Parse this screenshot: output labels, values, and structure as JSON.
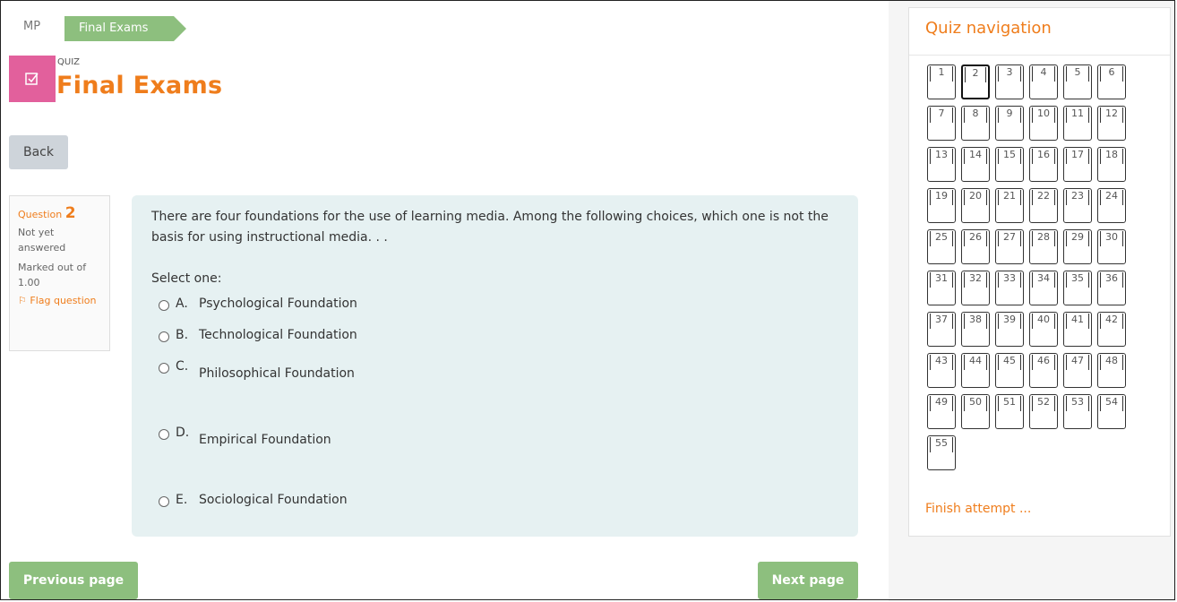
{
  "breadcrumb": {
    "root": "MP",
    "current": "Final Exams"
  },
  "quiz": {
    "label": "QUIZ",
    "title": "Final Exams"
  },
  "back_label": "Back",
  "question_info": {
    "question_word": "Question",
    "number": "2",
    "status": "Not yet answered",
    "marks": "Marked out of 1.00",
    "flag": "Flag question"
  },
  "question": {
    "text": "There are four foundations for the use of learning media. Among the following choices, which one is not the basis for using instructional media. . .",
    "select_label": "Select one:",
    "options": [
      {
        "letter": "A.",
        "text": "Psychological Foundation"
      },
      {
        "letter": "B.",
        "text": "Technological Foundation"
      },
      {
        "letter": "C.",
        "text": "Philosophical Foundation"
      },
      {
        "letter": "D.",
        "text": "Empirical Foundation"
      },
      {
        "letter": "E.",
        "text": "Sociological Foundation"
      }
    ]
  },
  "buttons": {
    "previous": "Previous page",
    "next": "Next page"
  },
  "nav": {
    "title": "Quiz navigation",
    "current": 2,
    "questions": [
      "1",
      "2",
      "3",
      "4",
      "5",
      "6",
      "7",
      "8",
      "9",
      "10",
      "11",
      "12",
      "13",
      "14",
      "15",
      "16",
      "17",
      "18",
      "19",
      "20",
      "21",
      "22",
      "23",
      "24",
      "25",
      "26",
      "27",
      "28",
      "29",
      "30",
      "31",
      "32",
      "33",
      "34",
      "35",
      "36",
      "37",
      "38",
      "39",
      "40",
      "41",
      "42",
      "43",
      "44",
      "45",
      "46",
      "47",
      "48",
      "49",
      "50",
      "51",
      "52",
      "53",
      "54",
      "55"
    ],
    "finish": "Finish attempt ..."
  },
  "colors": {
    "accent": "#ef7d1c",
    "green": "#8dbf7e",
    "pink": "#e2609c",
    "question_bg": "#e6f1f2"
  }
}
